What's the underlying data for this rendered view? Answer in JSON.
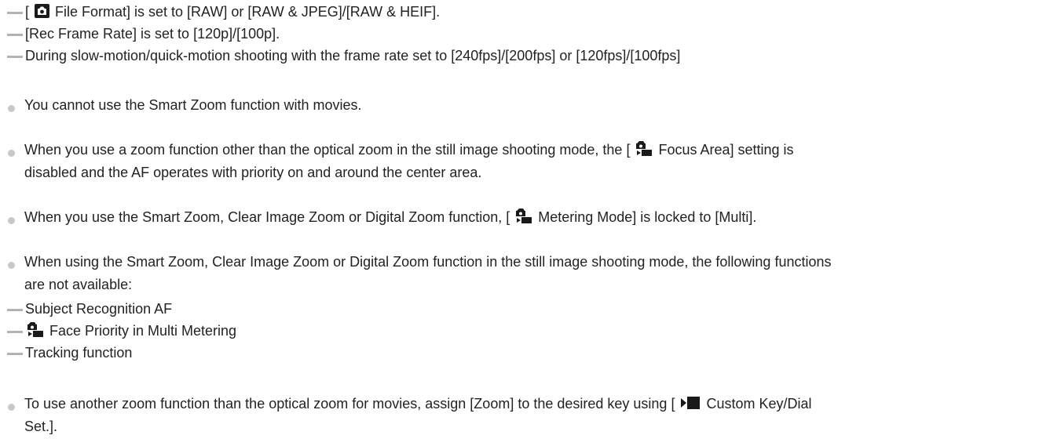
{
  "continued_conditions": [
    {
      "pre": "[ ",
      "icon": "still-camera-icon",
      "post": " File Format] is set to [RAW] or [RAW & JPEG]/[RAW & HEIF]."
    },
    {
      "pre": "",
      "icon": "",
      "post": "[Rec Frame Rate] is set to [120p]/[100p]."
    },
    {
      "pre": "",
      "icon": "",
      "post": "During slow-motion/quick-motion shooting with the frame rate set to [240fps]/[200fps] or [120fps]/[100fps]"
    }
  ],
  "notes": {
    "smart_zoom_movies": "You cannot use the Smart Zoom function with movies.",
    "focus_area": {
      "pre": "When you use a zoom function other than the optical zoom in the still image shooting mode, the [ ",
      "icon": "still-movie-camera-icon",
      "post_line1": " Focus Area] setting is",
      "line2": "disabled and the AF operates with priority on and around the center area."
    },
    "metering_mode": {
      "pre": "When you use the Smart Zoom, Clear Image Zoom or Digital Zoom function, [ ",
      "icon": "still-movie-camera-icon",
      "post": " Metering Mode] is locked to [Multi]."
    },
    "unavailable_functions": {
      "line1": "When using the Smart Zoom, Clear Image Zoom or Digital Zoom function in the still image shooting mode, the following functions",
      "line2": "are not available:",
      "items": [
        {
          "pre": "",
          "icon": "",
          "post": "Subject Recognition AF"
        },
        {
          "pre": "",
          "icon": "still-movie-camera-icon",
          "post": " Face Priority in Multi Metering"
        },
        {
          "pre": "",
          "icon": "",
          "post": "Tracking function"
        }
      ]
    },
    "movie_zoom": {
      "pre": "To use another zoom function than the optical zoom for movies, assign [Zoom] to the desired key using [ ",
      "icon": "movie-icon",
      "post_line1": " Custom Key/Dial",
      "line2": "Set.]."
    }
  },
  "colors": {
    "text": "#222222",
    "dash": "#b3b3b3",
    "bullet": "#c8c8c8",
    "icon": "#1a1a1a"
  }
}
